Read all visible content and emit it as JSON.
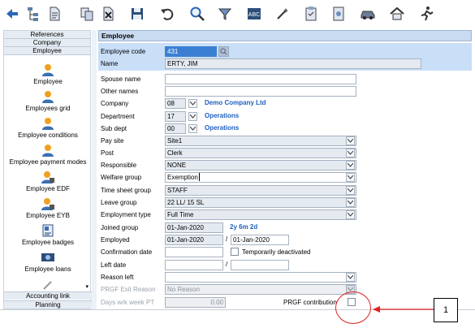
{
  "toolbar": {
    "icons": [
      "back-arrow-icon",
      "hierarchy-icon",
      "document-icon",
      "copy-icon",
      "delete-icon",
      "save-icon",
      "undo-icon",
      "search-icon",
      "filter-icon",
      "abc-icon",
      "magic-wand-icon",
      "clipboard-icon",
      "report-icon",
      "car-icon",
      "home-icon",
      "runner-icon"
    ]
  },
  "sidebar": {
    "sections": [
      "References",
      "Company",
      "Employee"
    ],
    "items": [
      {
        "label": "Employee"
      },
      {
        "label": "Employees grid"
      },
      {
        "label": "Employee conditions"
      },
      {
        "label": "Employee payment modes"
      },
      {
        "label": "Employee EDF"
      },
      {
        "label": "Employee EYB"
      },
      {
        "label": "Employee badges"
      },
      {
        "label": "Employee loans"
      }
    ],
    "bottom": [
      "Accounting link",
      "Planning"
    ]
  },
  "form": {
    "title": "Employee",
    "employee_code_label": "Employee code",
    "employee_code": "431",
    "name_label": "Name",
    "name": "ERTY, JIM",
    "spouse_label": "Spouse name",
    "spouse": "",
    "other_names_label": "Other names",
    "other_names": "",
    "company_label": "Company",
    "company_code": "08",
    "company_name": "Demo Company Ltd",
    "department_label": "Department",
    "department_code": "17",
    "department_name": "Operations",
    "subdept_label": "Sub dept",
    "subdept_code": "00",
    "subdept_name": "Operations",
    "paysite_label": "Pay site",
    "paysite": "Site1",
    "post_label": "Post",
    "post": "Clerk",
    "responsible_label": "Responsible",
    "responsible": "NONE",
    "welfare_label": "Welfare group",
    "welfare": "Exemption",
    "timesheet_label": "Time sheet group",
    "timesheet": "STAFF",
    "leave_label": "Leave group",
    "leave": "22 LL/ 15 SL",
    "emptype_label": "Employment type",
    "emptype": "Full Time",
    "joined_label": "Joined group",
    "joined": "01-Jan-2020",
    "joined_duration": "2y 6m 2d",
    "employed_label": "Employed",
    "employed_from": "01-Jan-2020",
    "employed_to": "01-Jan-2020",
    "confirmation_label": "Confirmation date",
    "temp_deactivated_label": "Temporarily deactivated",
    "left_label": "Left date",
    "reason_left_label": "Reason left",
    "prgf_exit_label": "PRGF Exit Reason",
    "prgf_exit": "No Reason",
    "days_wrk_label": "Days wrk week PT",
    "days_wrk": "0.00",
    "prgf_contrib_label": "PRGF contribution",
    "slash": "/"
  },
  "annotation": {
    "number": "1"
  },
  "colors": {
    "accent": "#3b7fd3",
    "link": "#1f5fbf",
    "annotation_red": "#e02020"
  }
}
